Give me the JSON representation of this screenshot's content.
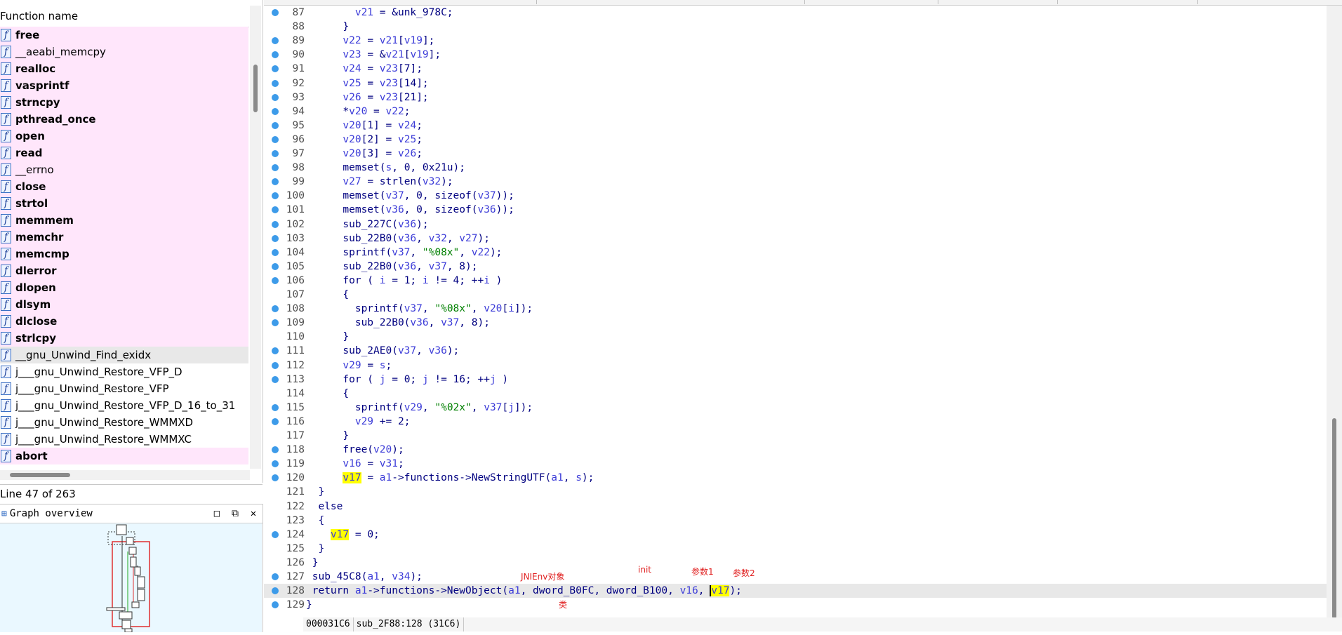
{
  "functions_panel": {
    "header": "Function name",
    "items": [
      {
        "name": "free",
        "bold": true,
        "imported": true
      },
      {
        "name": "__aeabi_memcpy",
        "bold": false,
        "imported": true
      },
      {
        "name": "realloc",
        "bold": true,
        "imported": true
      },
      {
        "name": "vasprintf",
        "bold": true,
        "imported": true
      },
      {
        "name": "strncpy",
        "bold": true,
        "imported": true
      },
      {
        "name": "pthread_once",
        "bold": true,
        "imported": true
      },
      {
        "name": "open",
        "bold": true,
        "imported": true
      },
      {
        "name": "read",
        "bold": true,
        "imported": true
      },
      {
        "name": "__errno",
        "bold": false,
        "imported": true
      },
      {
        "name": "close",
        "bold": true,
        "imported": true
      },
      {
        "name": "strtol",
        "bold": true,
        "imported": true
      },
      {
        "name": "memmem",
        "bold": true,
        "imported": true
      },
      {
        "name": "memchr",
        "bold": true,
        "imported": true
      },
      {
        "name": "memcmp",
        "bold": true,
        "imported": true
      },
      {
        "name": "dlerror",
        "bold": true,
        "imported": true
      },
      {
        "name": "dlopen",
        "bold": true,
        "imported": true
      },
      {
        "name": "dlsym",
        "bold": true,
        "imported": true
      },
      {
        "name": "dlclose",
        "bold": true,
        "imported": true
      },
      {
        "name": "strlcpy",
        "bold": true,
        "imported": true
      },
      {
        "name": "__gnu_Unwind_Find_exidx",
        "bold": false,
        "imported": false,
        "selected": true
      },
      {
        "name": "j___gnu_Unwind_Restore_VFP_D",
        "bold": false,
        "imported": false
      },
      {
        "name": "j___gnu_Unwind_Restore_VFP",
        "bold": false,
        "imported": false
      },
      {
        "name": "j___gnu_Unwind_Restore_VFP_D_16_to_31",
        "bold": false,
        "imported": false
      },
      {
        "name": "j___gnu_Unwind_Restore_WMMXD",
        "bold": false,
        "imported": false
      },
      {
        "name": "j___gnu_Unwind_Restore_WMMXC",
        "bold": false,
        "imported": false
      },
      {
        "name": "abort",
        "bold": true,
        "imported": true
      }
    ],
    "icon_glyph": "f",
    "status": "Line 47 of 263"
  },
  "graph_overview": {
    "title": "Graph overview",
    "buttons": {
      "maximize": "□",
      "float": "⧉",
      "close": "✕"
    }
  },
  "code": {
    "lines": [
      {
        "n": "87",
        "bp": true,
        "html": "    <span class='v'>v21</span> = &amp;unk_978C;"
      },
      {
        "n": "88",
        "bp": false,
        "html": "  }"
      },
      {
        "n": "89",
        "bp": true,
        "html": "  <span class='v'>v22</span> = <span class='v'>v21</span>[<span class='v'>v19</span>];"
      },
      {
        "n": "90",
        "bp": true,
        "html": "  <span class='v'>v23</span> = &amp;<span class='v'>v21</span>[<span class='v'>v19</span>];"
      },
      {
        "n": "91",
        "bp": true,
        "html": "  <span class='v'>v24</span> = <span class='v'>v23</span>[7];"
      },
      {
        "n": "92",
        "bp": true,
        "html": "  <span class='v'>v25</span> = <span class='v'>v23</span>[14];"
      },
      {
        "n": "93",
        "bp": true,
        "html": "  <span class='v'>v26</span> = <span class='v'>v23</span>[21];"
      },
      {
        "n": "94",
        "bp": true,
        "html": "  *<span class='v'>v20</span> = <span class='v'>v22</span>;"
      },
      {
        "n": "95",
        "bp": true,
        "html": "  <span class='v'>v20</span>[1] = <span class='v'>v24</span>;"
      },
      {
        "n": "96",
        "bp": true,
        "html": "  <span class='v'>v20</span>[2] = <span class='v'>v25</span>;"
      },
      {
        "n": "97",
        "bp": true,
        "html": "  <span class='v'>v20</span>[3] = <span class='v'>v26</span>;"
      },
      {
        "n": "98",
        "bp": true,
        "html": "  memset(<span class='v'>s</span>, 0, 0x21u);"
      },
      {
        "n": "99",
        "bp": true,
        "html": "  <span class='v'>v27</span> = strlen(<span class='v'>v32</span>);"
      },
      {
        "n": "100",
        "bp": true,
        "html": "  memset(<span class='v'>v37</span>, 0, sizeof(<span class='v'>v37</span>));"
      },
      {
        "n": "101",
        "bp": true,
        "html": "  memset(<span class='v'>v36</span>, 0, sizeof(<span class='v'>v36</span>));"
      },
      {
        "n": "102",
        "bp": true,
        "html": "  sub_227C(<span class='v'>v36</span>);"
      },
      {
        "n": "103",
        "bp": true,
        "html": "  sub_22B0(<span class='v'>v36</span>, <span class='v'>v32</span>, <span class='v'>v27</span>);"
      },
      {
        "n": "104",
        "bp": true,
        "html": "  sprintf(<span class='v'>v37</span>, <span class='s'>\"%08x\"</span>, <span class='v'>v22</span>);"
      },
      {
        "n": "105",
        "bp": true,
        "html": "  sub_22B0(<span class='v'>v36</span>, <span class='v'>v37</span>, 8);"
      },
      {
        "n": "106",
        "bp": true,
        "html": "  for ( <span class='v'>i</span> = 1; <span class='v'>i</span> != 4; ++<span class='v'>i</span> )"
      },
      {
        "n": "107",
        "bp": false,
        "html": "  {"
      },
      {
        "n": "108",
        "bp": true,
        "html": "    sprintf(<span class='v'>v37</span>, <span class='s'>\"%08x\"</span>, <span class='v'>v20</span>[<span class='v'>i</span>]);"
      },
      {
        "n": "109",
        "bp": true,
        "html": "    sub_22B0(<span class='v'>v36</span>, <span class='v'>v37</span>, 8);"
      },
      {
        "n": "110",
        "bp": false,
        "html": "  }"
      },
      {
        "n": "111",
        "bp": true,
        "html": "  sub_2AE0(<span class='v'>v37</span>, <span class='v'>v36</span>);"
      },
      {
        "n": "112",
        "bp": true,
        "html": "  <span class='v'>v29</span> = <span class='v'>s</span>;"
      },
      {
        "n": "113",
        "bp": true,
        "html": "  for ( <span class='v'>j</span> = 0; <span class='v'>j</span> != 16; ++<span class='v'>j</span> )"
      },
      {
        "n": "114",
        "bp": false,
        "html": "  {"
      },
      {
        "n": "115",
        "bp": true,
        "html": "    sprintf(<span class='v'>v29</span>, <span class='s'>\"%02x\"</span>, <span class='v'>v37</span>[<span class='v'>j</span>]);"
      },
      {
        "n": "116",
        "bp": true,
        "html": "    <span class='v'>v29</span> += 2;"
      },
      {
        "n": "117",
        "bp": false,
        "html": "  }"
      },
      {
        "n": "118",
        "bp": true,
        "html": "  free(<span class='v'>v20</span>);"
      },
      {
        "n": "119",
        "bp": true,
        "html": "  <span class='v'>v16</span> = <span class='v'>v31</span>;"
      },
      {
        "n": "120",
        "bp": true,
        "html": "  <span class='v hl'>v17</span> = <span class='v'>a1</span>-&gt;functions-&gt;NewStringUTF(<span class='v'>a1</span>, <span class='v'>s</span>);"
      },
      {
        "n": "121",
        "bp": false,
        "html": "}"
      },
      {
        "n": "122",
        "bp": false,
        "html": "else"
      },
      {
        "n": "123",
        "bp": false,
        "html": "{"
      },
      {
        "n": "124",
        "bp": true,
        "html": "  <span class='v hl'>v17</span> = 0;"
      },
      {
        "n": "125",
        "bp": false,
        "html": "}"
      },
      {
        "n": "126",
        "bp": false,
        "html": "}"
      },
      {
        "n": "127",
        "bp": true,
        "html": "sub_45C8(<span class='v'>a1</span>, <span class='v'>v34</span>);"
      },
      {
        "n": "128",
        "bp": true,
        "current": true,
        "html": "return <span class='v'>a1</span>-&gt;functions-&gt;NewObject(<span class='v'>a1</span>, dword_B0FC, dword_B100, <span class='v'>v16</span>, <span class='v hl'><span class='caret'></span>v17</span>);"
      },
      {
        "n": "129",
        "bp": true,
        "html": "}"
      }
    ],
    "indents": [
      -1,
      -1,
      -1,
      -1,
      -1,
      -1,
      -1,
      -1,
      -1,
      -1,
      -1,
      -1,
      -1,
      -1,
      -1,
      -1,
      -1,
      -1,
      -1,
      -1,
      -1,
      -1,
      -1,
      -1,
      -1,
      -1,
      -1,
      -1,
      -1,
      -1,
      -1,
      -1,
      -1,
      -1,
      -1,
      -1,
      -1,
      -1,
      -1,
      -1,
      -1,
      -1,
      -1
    ],
    "annotations": {
      "jnienv": "JNIEnv对象",
      "init": "init",
      "param1": "参数1",
      "param2": "参数2",
      "class": "类"
    }
  },
  "status_bar": {
    "address": "000031C6",
    "location": "sub_2F88:128 (31C6)"
  }
}
